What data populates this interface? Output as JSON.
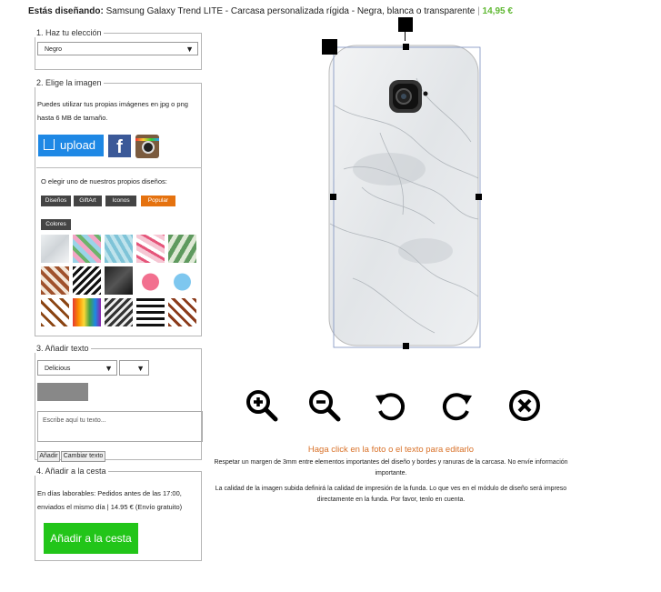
{
  "header": {
    "lead": "Estás diseñando:",
    "product": "Samsung Galaxy Trend LITE - Carcasa personalizada rígida - Negra, blanca o transparente",
    "separator": "|",
    "price": "14,95 €"
  },
  "step1": {
    "legend": "1. Haz tu elección",
    "select_value": "Negro"
  },
  "step2": {
    "legend": "2. Elige la imagen",
    "intro": "Puedes utilizar tus propias imágenes en jpg o png hasta 6 MB de tamaño.",
    "upload_label": "upload",
    "facebook_label": "f",
    "designs_intro": "O elegir uno de nuestros propios diseños:",
    "categories": [
      "Diseños",
      "GiftArt",
      "Iconos",
      "Popular",
      "Colores"
    ]
  },
  "step3": {
    "legend": "3. Añadir texto",
    "font_value": "Delicious",
    "textarea_placeholder": "Escribe aquí tu texto...",
    "add_button": "Añadir",
    "change_button": "Cambiar texto"
  },
  "step4": {
    "legend": "4. Añadir a la cesta",
    "shipping": "En días laborables: Pedidos antes de las 17:00, enviados el mismo día | 14.95 € (Envío gratuito)",
    "cta": "Añadir a la cesta"
  },
  "editor": {
    "hint": "Haga click en la foto o el texto para editarlo",
    "note1": "Respetar un margen de 3mm entre elementos importantes del diseño y bordes y ranuras de la carcasa. No envíe información importante.",
    "note2": "La calidad de la imagen subida definirá la calidad de impresión de la funda. Lo que ves en el módulo de diseño será impreso directamente en la funda. Por favor, tenlo en cuenta.",
    "tools": [
      "zoom-in-icon",
      "zoom-out-icon",
      "rotate-left-icon",
      "rotate-right-icon",
      "delete-icon"
    ]
  },
  "colors": {
    "accent": "#e5720f",
    "price": "#5fb832",
    "cta": "#22c519",
    "upload": "#1e88e5"
  }
}
